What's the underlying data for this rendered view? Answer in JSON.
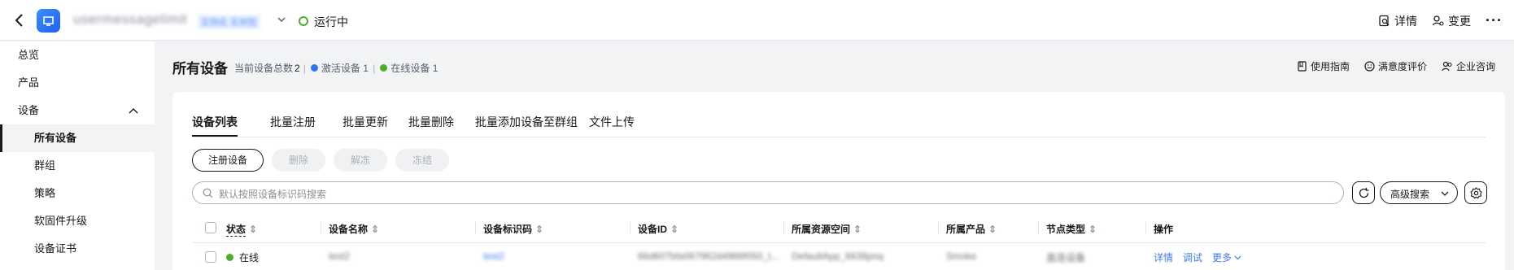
{
  "topbar": {
    "instance_name": "usermessagelimit",
    "instance_tag": "实例名 实例型",
    "status_text": "运行中",
    "actions": {
      "details": "详情",
      "change": "变更",
      "more": "···"
    }
  },
  "sidebar": {
    "items": [
      {
        "label": "总览"
      },
      {
        "label": "产品"
      },
      {
        "label": "设备"
      },
      {
        "label": "所有设备"
      },
      {
        "label": "群组"
      },
      {
        "label": "策略"
      },
      {
        "label": "软固件升级"
      },
      {
        "label": "设备证书"
      }
    ]
  },
  "page": {
    "title": "所有设备",
    "stats": {
      "total_label": "当前设备总数",
      "total": "2",
      "active_label": "激活设备",
      "active": "1",
      "online_label": "在线设备",
      "online": "1",
      "active_color": "#2f74f5",
      "online_color": "#4cae2c"
    },
    "links": {
      "guide": "使用指南",
      "rating": "满意度评价",
      "consult": "企业咨询"
    }
  },
  "tabs": [
    "设备列表",
    "批量注册",
    "批量更新",
    "批量删除",
    "批量添加设备至群组",
    "文件上传"
  ],
  "toolbar": {
    "register": "注册设备",
    "delete": "删除",
    "unfreeze": "解冻",
    "freeze": "冻结"
  },
  "search": {
    "placeholder": "默认按照设备标识码搜索",
    "advanced": "高级搜索"
  },
  "table": {
    "columns": [
      "状态",
      "设备名称",
      "设备标识码",
      "设备ID",
      "所属资源空间",
      "所属产品",
      "节点类型",
      "操作"
    ],
    "rows": [
      {
        "status": "在线",
        "name": "test2",
        "identifier": "test2",
        "device_id": "66d607bfa067962d4966f050_t...",
        "space": "DefaultApp_6638pnq",
        "product": "Smoke",
        "node_type": "直连设备",
        "ops": {
          "detail": "详情",
          "debug": "调试",
          "more": "更多"
        }
      }
    ]
  },
  "colors": {
    "accent": "#191919",
    "link": "#3f7cf5",
    "online": "#4cae2c"
  }
}
